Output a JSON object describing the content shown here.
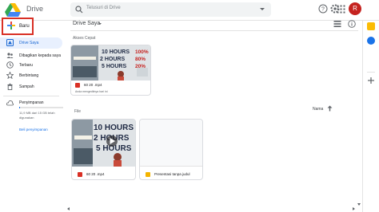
{
  "app": {
    "title": "Drive"
  },
  "search": {
    "placeholder": "Telusuri di Drive"
  },
  "header": {
    "avatar_initial": "R"
  },
  "sidebar": {
    "new_label": "Baru",
    "items": [
      {
        "label": "Drive Saya",
        "icon": "my-drive-icon",
        "active": true
      },
      {
        "label": "Dibagikan kepada saya",
        "icon": "shared-icon"
      },
      {
        "label": "Terbaru",
        "icon": "clock-icon"
      },
      {
        "label": "Berbintang",
        "icon": "star-icon"
      },
      {
        "label": "Sampah",
        "icon": "trash-icon"
      }
    ],
    "storage": {
      "title": "Penyimpanan",
      "usage_text": "11,9 MB dari 15 GB telah digunakan",
      "usage_fraction": 0.001,
      "buy_label": "Beli penyimpanan"
    }
  },
  "main": {
    "title": "Drive Saya",
    "quick_access_label": "Akses Cepat",
    "files_label": "File",
    "sort_label": "Nama",
    "quick_access": [
      {
        "name": "60 20 .mp4",
        "subtitle": "Anda mengeditnya hari ini",
        "thumb_lines": [
          "10 HOURS",
          "2 HOURS",
          "5 HOURS"
        ],
        "thumb_pcts": [
          "100%",
          "80%",
          "20%"
        ]
      }
    ],
    "files": [
      {
        "name": "60 20 .mp4",
        "type": "video",
        "thumb_lines": [
          "10 HOURS",
          "2 HOURS",
          "5 HOURS"
        ]
      },
      {
        "name": "Presentasi tanpa judul",
        "type": "slides"
      }
    ]
  },
  "colors": {
    "accent": "#1a73e8",
    "highlight_box": "#d93025",
    "video_icon": "#d93025",
    "slides_icon": "#f4b400"
  }
}
